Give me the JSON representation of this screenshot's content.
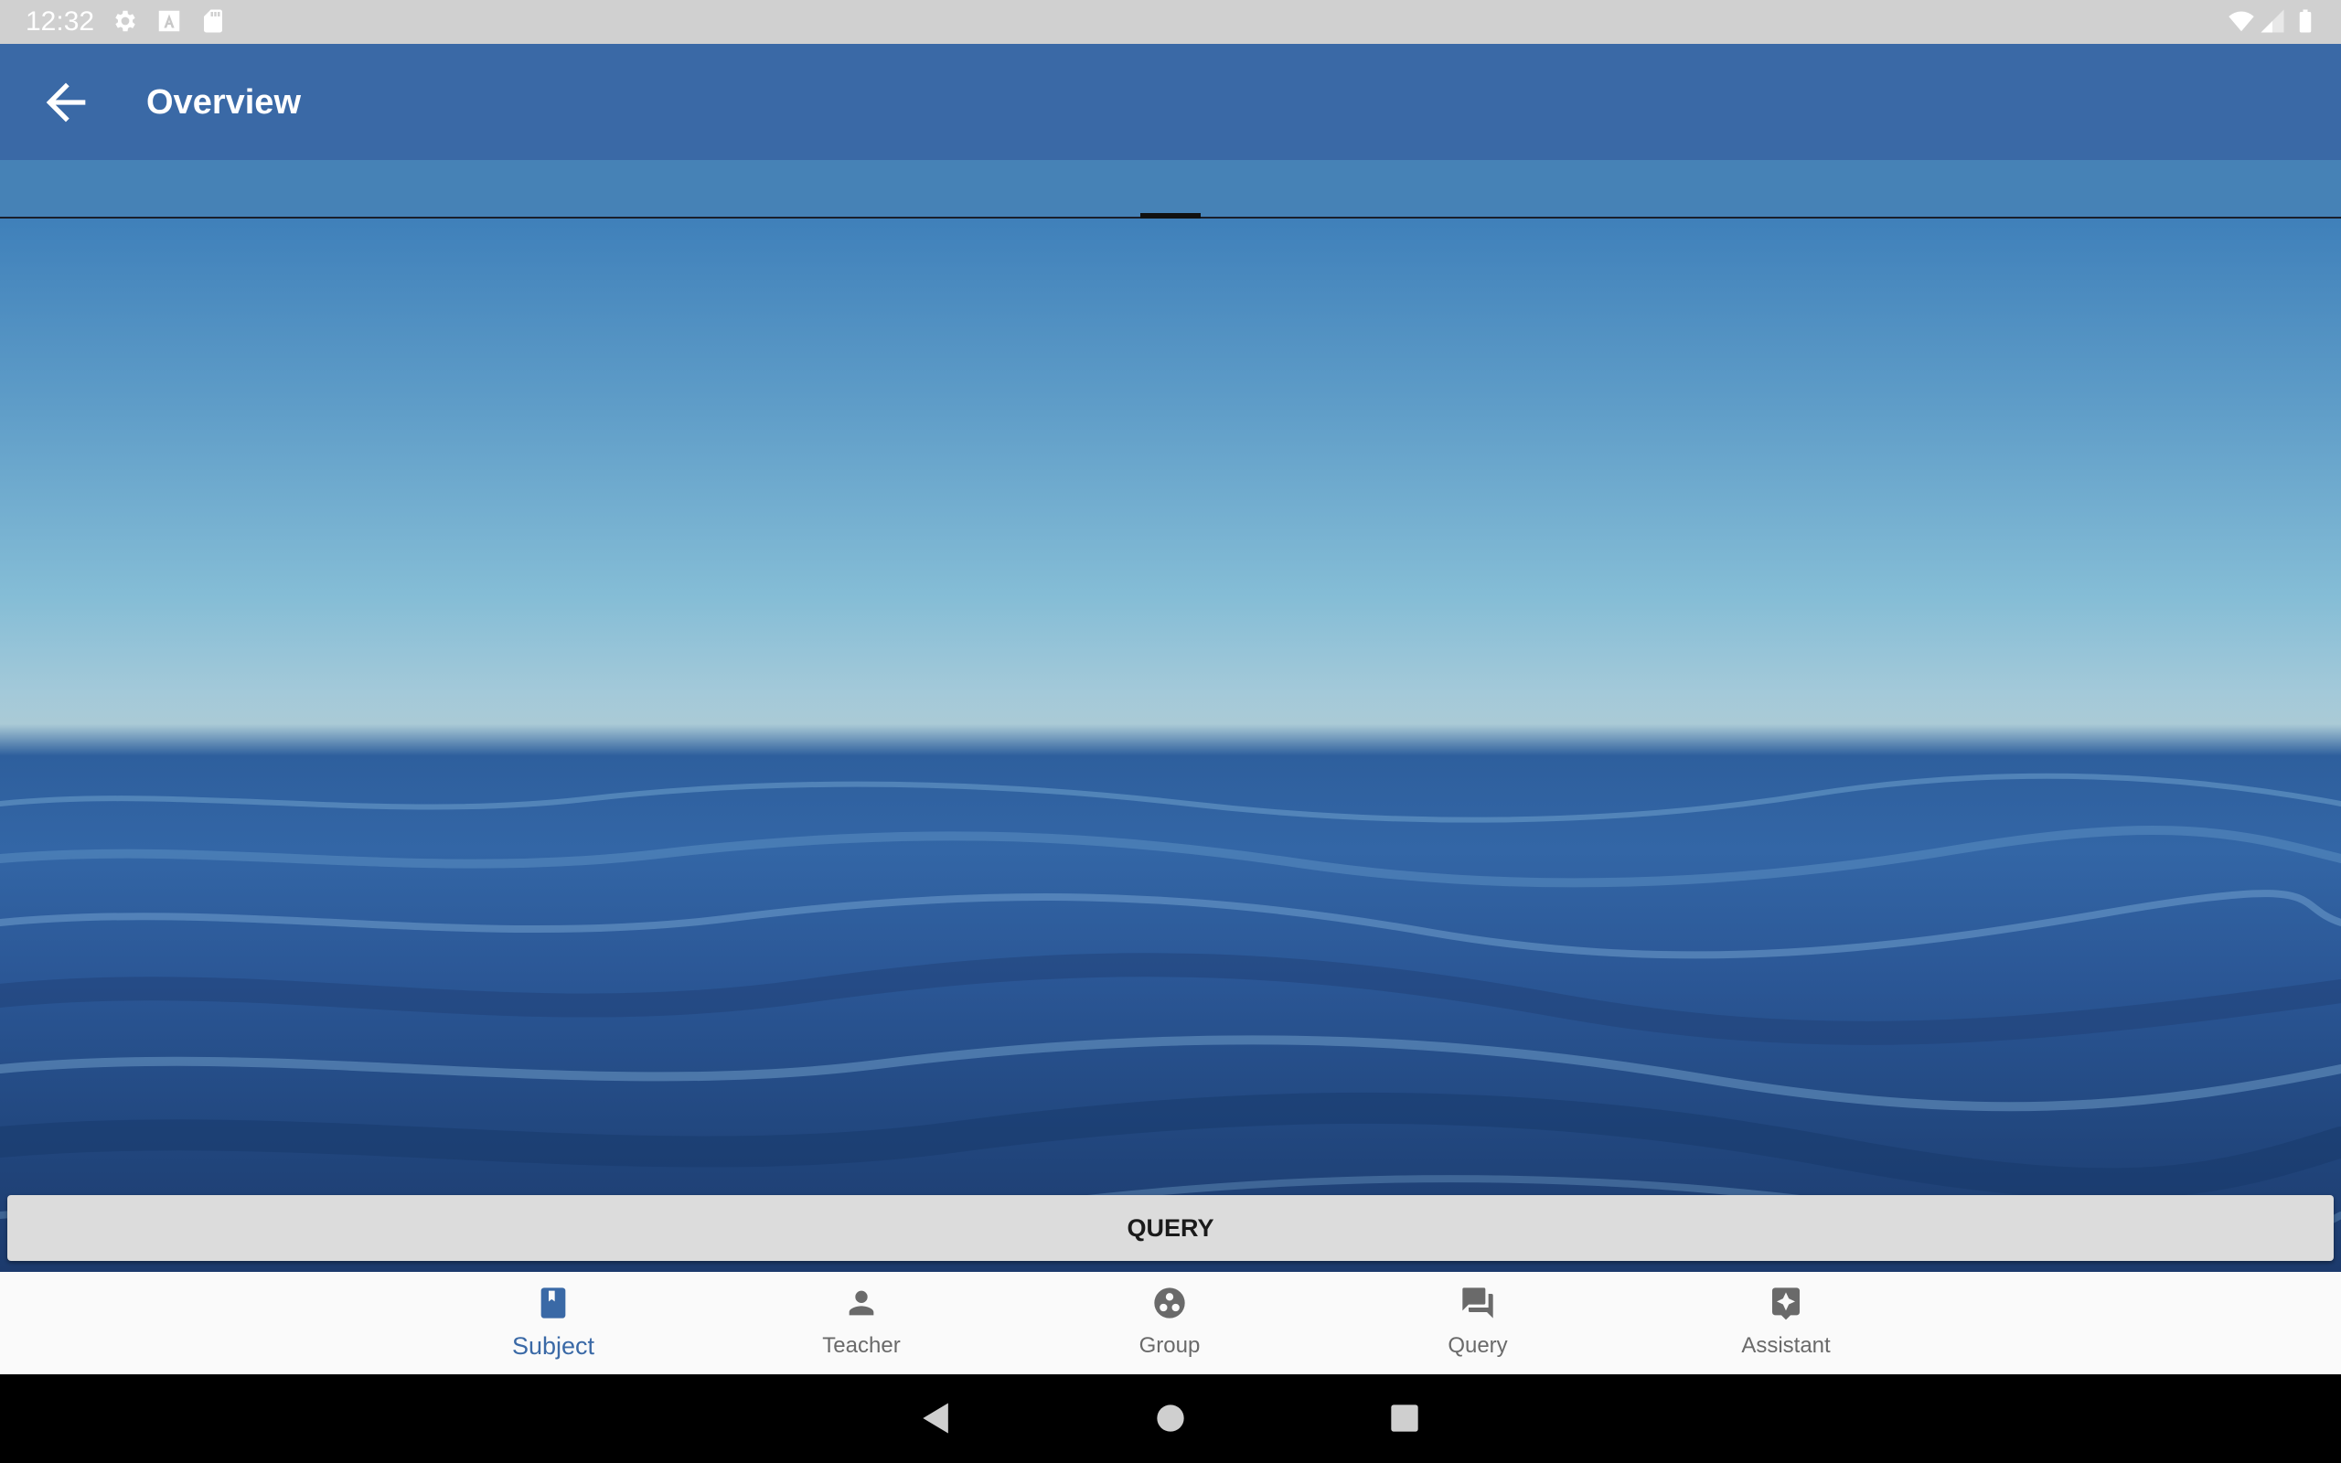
{
  "status_bar": {
    "time": "12:32",
    "icons": [
      "gear-icon",
      "font-a-icon",
      "sd-card-icon",
      "wifi-icon",
      "cell-signal-icon",
      "battery-icon"
    ]
  },
  "app_bar": {
    "title": "Overview",
    "back_icon": "arrow-back-icon"
  },
  "main": {
    "query_button_label": "QUERY"
  },
  "bottom_nav": {
    "items": [
      {
        "label": "Subject",
        "icon": "book-icon",
        "active": true
      },
      {
        "label": "Teacher",
        "icon": "person-icon",
        "active": false
      },
      {
        "label": "Group",
        "icon": "group-icon",
        "active": false
      },
      {
        "label": "Query",
        "icon": "chat-icon",
        "active": false
      },
      {
        "label": "Assistant",
        "icon": "assistant-icon",
        "active": false
      }
    ]
  },
  "system_nav": {
    "buttons": [
      "back-triangle-icon",
      "home-circle-icon",
      "recents-square-icon"
    ]
  },
  "colors": {
    "primary": "#3a69a6",
    "tab_strip": "#4682b6",
    "status_bar": "#d0d0d0",
    "nav_active": "#3a69a6",
    "nav_inactive": "#6a6a6a"
  }
}
